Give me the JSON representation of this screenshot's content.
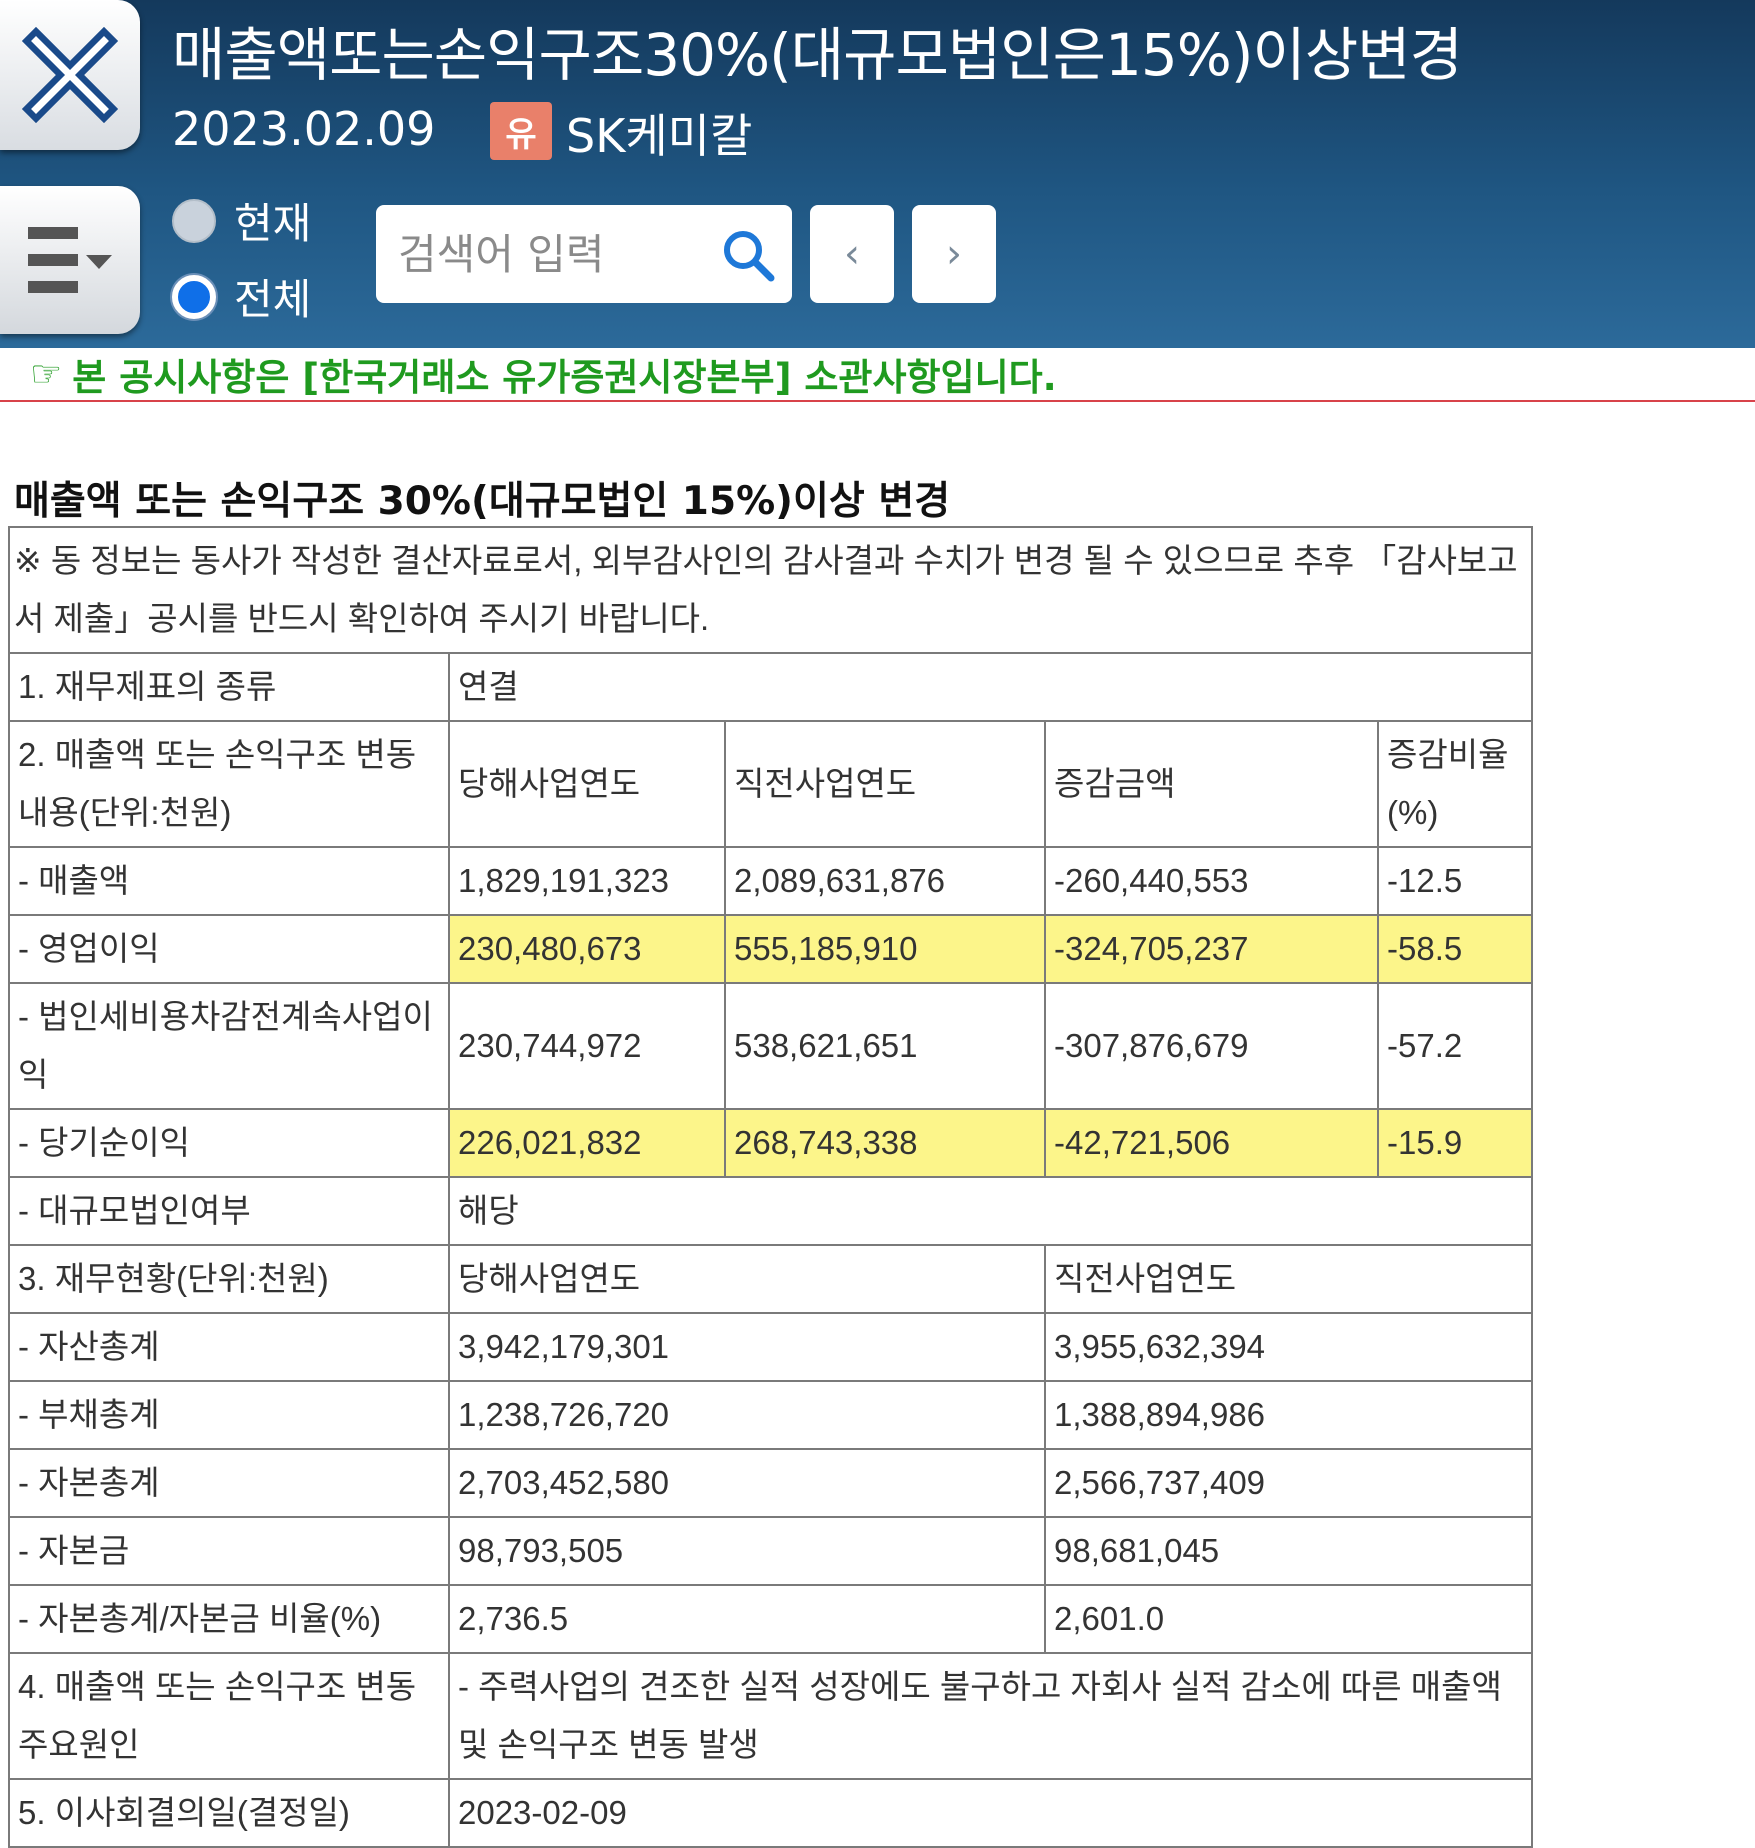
{
  "header": {
    "title": "매출액또는손익구조30%(대규모법인은15%)이상변경",
    "date": "2023.02.09",
    "market_badge": "유",
    "company": "SK케미칼",
    "radio_current": "현재",
    "radio_all": "전체",
    "selected_radio": "전체",
    "search_placeholder": "검색어 입력",
    "prev_label": "‹",
    "next_label": "›"
  },
  "notice": {
    "hand": "☞",
    "text": "본 공시사항은 [한국거래소 유가증권시장본부] 소관사항입니다.",
    "color": "#1f9a1f"
  },
  "section_title": "매출액 또는 손익구조 30%(대규모법인 15%)이상 변경",
  "table": {
    "note": "※ 동 정보는 동사가 작성한 결산자료로서, 외부감사인의 감사결과 수치가 변경 될 수 있으므로 추후 「감사보고서 제출」공시를 반드시 확인하여 주시기 바랍니다.",
    "row1": {
      "label": "1. 재무제표의 종류",
      "value": "연결"
    },
    "row2": {
      "label": "2. 매출액 또는 손익구조 변동내용(단위:천원)",
      "headers": [
        "당해사업연도",
        "직전사업연도",
        "증감금액",
        "증감비율(%)"
      ]
    },
    "changes": [
      {
        "label": "- 매출액",
        "current": "1,829,191,323",
        "previous": "2,089,631,876",
        "diff": "-260,440,553",
        "ratio": "-12.5",
        "highlighted": false
      },
      {
        "label": "- 영업이익",
        "current": "230,480,673",
        "previous": "555,185,910",
        "diff": "-324,705,237",
        "ratio": "-58.5",
        "highlighted": true
      },
      {
        "label": "- 법인세비용차감전계속사업이익",
        "current": "230,744,972",
        "previous": "538,621,651",
        "diff": "-307,876,679",
        "ratio": "-57.2",
        "highlighted": false
      },
      {
        "label": "- 당기순이익",
        "current": "226,021,832",
        "previous": "268,743,338",
        "diff": "-42,721,506",
        "ratio": "-15.9",
        "highlighted": true
      }
    ],
    "large_corp": {
      "label": "- 대규모법인여부",
      "value": "해당"
    },
    "row3": {
      "label": "3. 재무현황(단위:천원)",
      "col_current": "당해사업연도",
      "col_previous": "직전사업연도"
    },
    "financials": [
      {
        "label": "- 자산총계",
        "current": "3,942,179,301",
        "previous": "3,955,632,394"
      },
      {
        "label": "- 부채총계",
        "current": "1,238,726,720",
        "previous": "1,388,894,986"
      },
      {
        "label": "- 자본총계",
        "current": "2,703,452,580",
        "previous": "2,566,737,409"
      },
      {
        "label": "- 자본금",
        "current": "98,793,505",
        "previous": "98,681,045"
      },
      {
        "label": "- 자본총계/자본금 비율(%)",
        "current": "2,736.5",
        "previous": "2,601.0"
      }
    ],
    "row4": {
      "label": "4. 매출액 또는 손익구조 변동 주요원인",
      "value": "- 주력사업의 견조한 실적 성장에도 불구하고 자회사 실적 감소에 따른 매출액 및 손익구조 변동 발생"
    },
    "row5": {
      "label": "5. 이사회결의일(결정일)",
      "value": "2023-02-09"
    }
  },
  "colors": {
    "header_bg": "#1f5682",
    "highlight": "#fcf58a",
    "notice_line": "#d8434a"
  },
  "icons": [
    "close-icon",
    "menu-icon",
    "search-icon",
    "chevron-left-icon",
    "chevron-right-icon",
    "pointing-hand-icon"
  ]
}
